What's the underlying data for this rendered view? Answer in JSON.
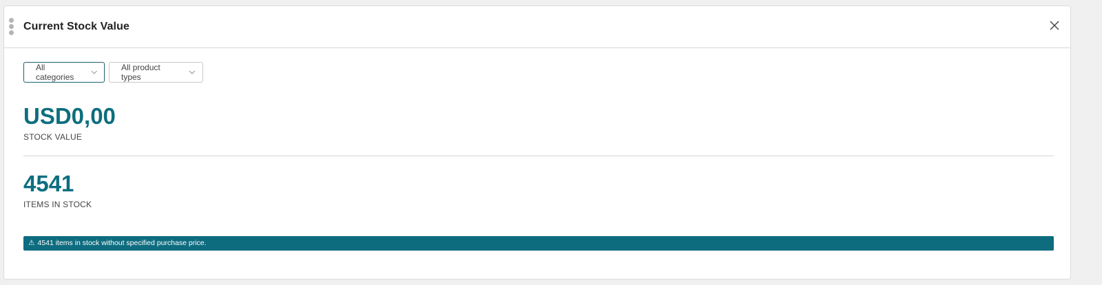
{
  "widget": {
    "title": "Current Stock Value",
    "drag_handle_icon": "drag-handle-icon",
    "close_icon": "close-icon"
  },
  "filters": {
    "category": {
      "selected": "All categories",
      "icon": "chevron-down-icon"
    },
    "product_type": {
      "selected": "All product types",
      "icon": "chevron-down-icon"
    }
  },
  "metrics": {
    "stock_value": {
      "value": "USD0,00",
      "label": "STOCK VALUE"
    },
    "items_in_stock": {
      "value": "4541",
      "label": "ITEMS IN STOCK"
    }
  },
  "alert": {
    "icon": "⚠",
    "text": "4541 items in stock without specified purchase price."
  },
  "colors": {
    "accent": "#0d6e7f",
    "alert_bg": "#0e6c7f"
  }
}
